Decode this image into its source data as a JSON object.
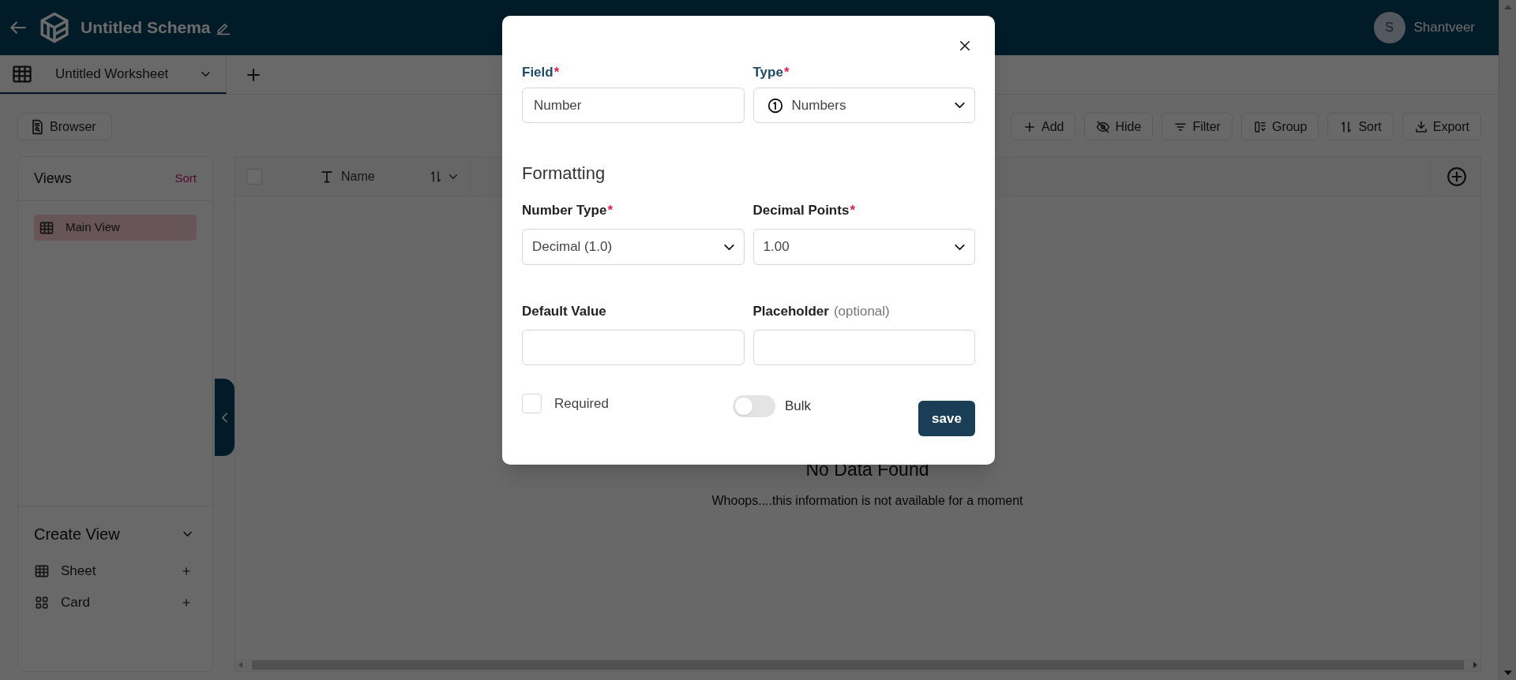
{
  "header": {
    "title": "Untitled Schema",
    "user": {
      "initial": "S",
      "name": "Shantveer"
    }
  },
  "tabs": [
    {
      "label": "Untitled Worksheet",
      "selected": true
    }
  ],
  "toolbar": {
    "left": [
      {
        "label": "Browser"
      }
    ],
    "right": [
      {
        "label": "Add"
      },
      {
        "label": "Hide"
      },
      {
        "label": "Filter"
      },
      {
        "label": "Group"
      },
      {
        "label": "Sort"
      },
      {
        "label": "Export"
      }
    ]
  },
  "sidebar": {
    "title": "Views",
    "sort_label": "Sort",
    "views": [
      {
        "label": "Main View",
        "selected": true
      }
    ],
    "create_view": {
      "title": "Create View",
      "expanded": true,
      "items": [
        {
          "label": "Sheet",
          "kind": "sheet"
        },
        {
          "label": "Card",
          "kind": "card"
        }
      ]
    }
  },
  "table": {
    "select_all_checked": false,
    "columns": [
      {
        "label": "Name"
      }
    ],
    "empty": {
      "title": "No Data Found",
      "message": "Whoops....this information is not available for a moment"
    }
  },
  "dialog": {
    "top_fields": [
      {
        "label": "Field",
        "required_mark": "*",
        "kind": "input",
        "value": "Number"
      },
      {
        "label": "Type",
        "required_mark": "*",
        "kind": "type-select",
        "value": "Numbers"
      }
    ],
    "formatting": {
      "title": "Formatting",
      "fields": [
        {
          "label": "Number Type",
          "required_mark": "*",
          "kind": "select",
          "value": "Decimal (1.0)"
        },
        {
          "label": "Decimal Points",
          "required_mark": "*",
          "kind": "select",
          "value": "1.00"
        }
      ]
    },
    "extra_fields": [
      {
        "label": "Default Value",
        "kind": "input"
      },
      {
        "label": "Placeholder",
        "hint": "(optional)",
        "kind": "input"
      }
    ],
    "required": {
      "label": "Required",
      "checked": false
    },
    "bulk": {
      "label": "Bulk",
      "on": false
    },
    "save_label": "save"
  }
}
